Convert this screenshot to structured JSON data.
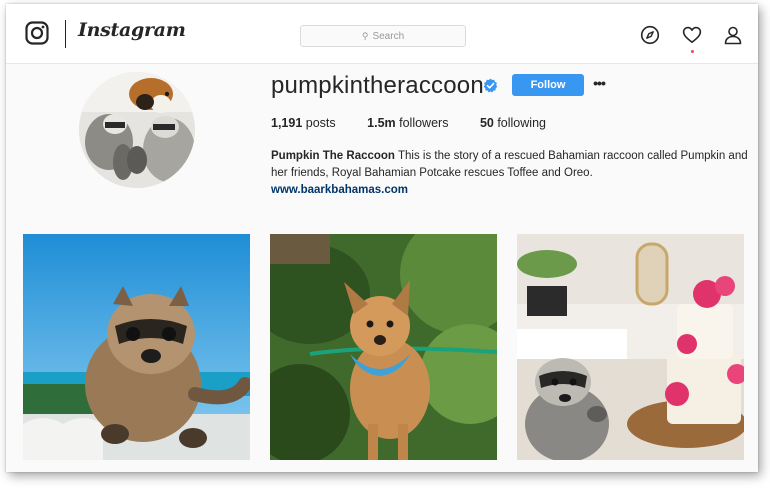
{
  "nav": {
    "brand": "Instagram",
    "search_placeholder": "Search",
    "icons": [
      "instagram-camera-icon",
      "compass-icon",
      "heart-icon",
      "profile-icon",
      "search-icon"
    ]
  },
  "profile": {
    "username": "pumpkintheraccoon",
    "verified": true,
    "follow_label": "Follow",
    "more_label": "•••",
    "stats": {
      "posts_count": "1,191",
      "posts_label": "posts",
      "followers_count": "1.5m",
      "followers_label": "followers",
      "following_count": "50",
      "following_label": "following"
    },
    "bio": {
      "name": "Pumpkin The Raccoon",
      "text": "This is the story of a rescued Bahamian raccoon called Pumpkin and her friends, Royal Bahamian Potcake rescues Toffee and Oreo.",
      "link": "www.baarkbahamas.com"
    }
  },
  "colors": {
    "accent": "#3897f0",
    "link": "#003569",
    "notification": "#ed4956"
  }
}
